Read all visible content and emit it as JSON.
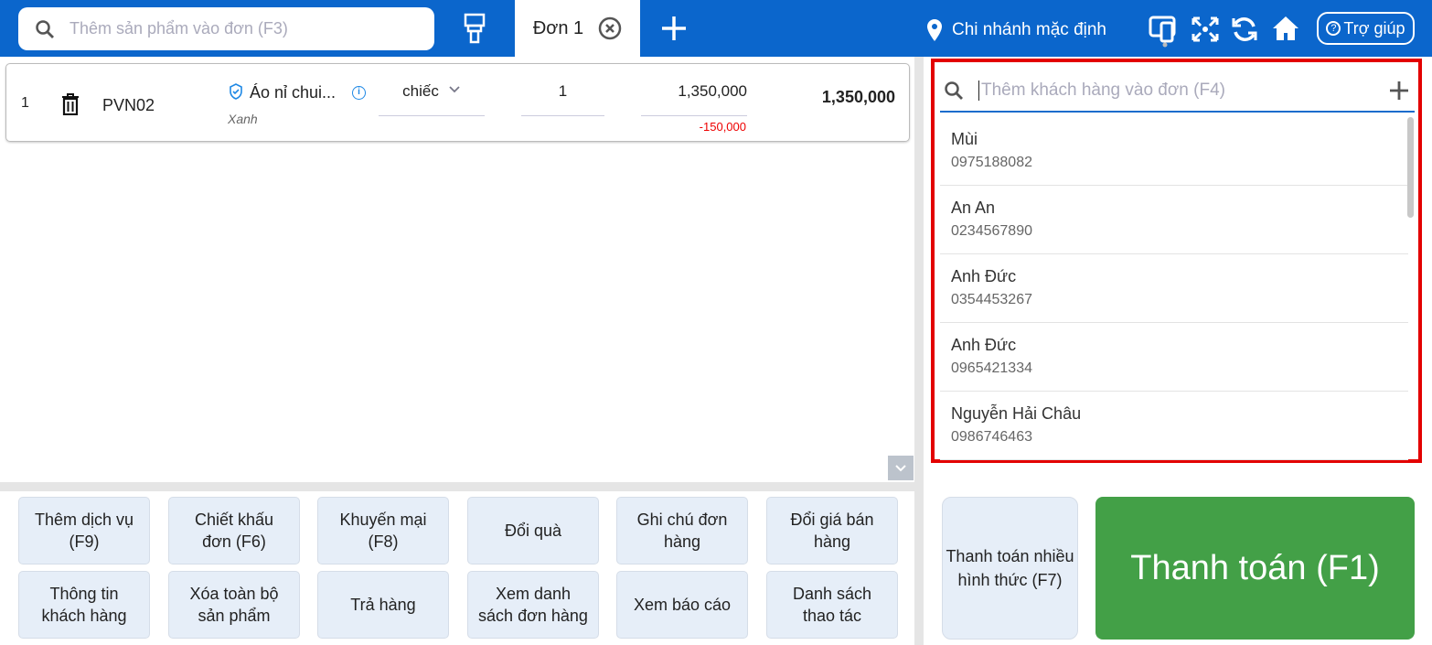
{
  "header": {
    "search_placeholder": "Thêm sản phẩm vào đơn (F3)",
    "tab_label": "Đơn 1",
    "branch": "Chi nhánh mặc định",
    "help": "Trợ giúp"
  },
  "order_line": {
    "index": "1",
    "code": "PVN02",
    "name": "Áo nỉ chui...",
    "variant": "Xanh",
    "unit": "chiếc",
    "qty": "1",
    "price": "1,350,000",
    "discount": "-150,000",
    "total": "1,350,000"
  },
  "customer": {
    "search_placeholder": "Thêm khách hàng vào đơn (F4)",
    "list": [
      {
        "name": "Mùi",
        "phone": "0975188082"
      },
      {
        "name": "An An",
        "phone": "0234567890"
      },
      {
        "name": "Anh Đức",
        "phone": "0354453267"
      },
      {
        "name": "Anh Đức",
        "phone": "0965421334"
      },
      {
        "name": "Nguyễn Hải Châu",
        "phone": "0986746463"
      }
    ]
  },
  "actions": [
    "Thêm dịch vụ (F9)",
    "Chiết khấu đơn (F6)",
    "Khuyến mại (F8)",
    "Đổi quà",
    "Ghi chú đơn hàng",
    "Đổi giá bán hàng",
    "Thông tin khách hàng",
    "Xóa toàn bộ sản phẩm",
    "Trả hàng",
    "Xem danh sách đơn hàng",
    "Xem báo cáo",
    "Danh sách thao tác"
  ],
  "payment": {
    "multi": "Thanh toán nhiều hình thức (F7)",
    "main": "Thanh toán (F1)"
  },
  "colors": {
    "header": "#0b66cc",
    "pay": "#43a047",
    "highlight": "#e30000"
  }
}
